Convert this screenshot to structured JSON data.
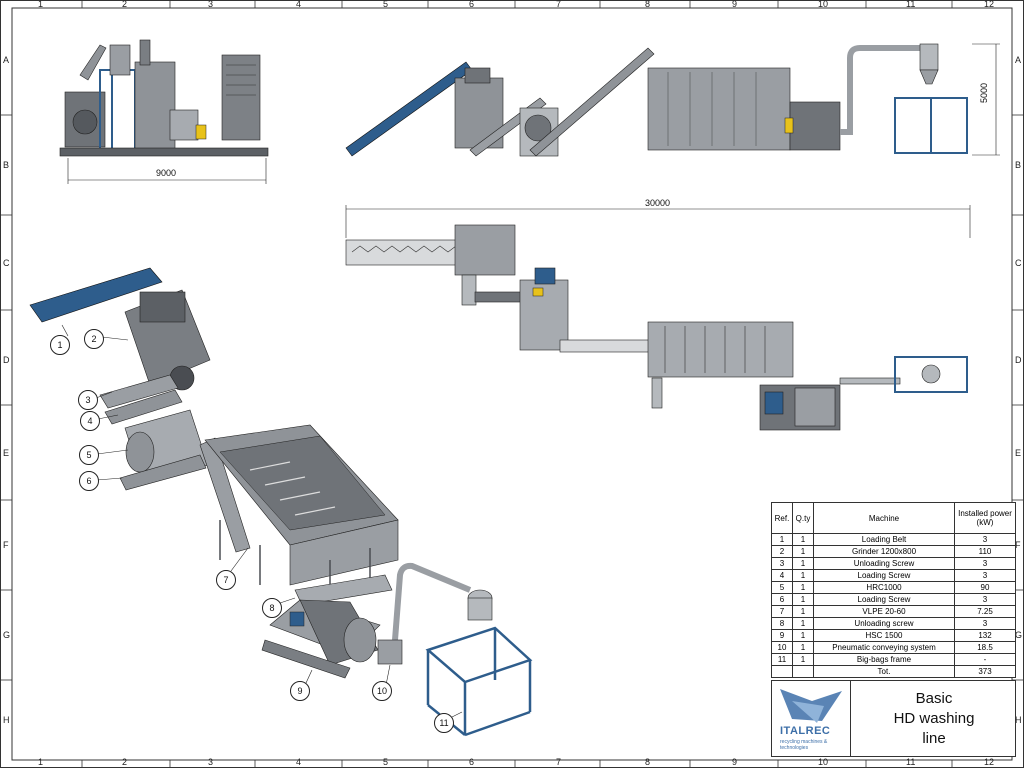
{
  "frame": {
    "col_numbers": [
      "1",
      "2",
      "3",
      "4",
      "5",
      "6",
      "7",
      "8",
      "9",
      "10",
      "11",
      "12"
    ],
    "row_letters": [
      "A",
      "B",
      "C",
      "D",
      "E",
      "F",
      "G",
      "H"
    ]
  },
  "dimensions": {
    "width_9000": "9000",
    "length_30000": "30000",
    "height_5000": "5000"
  },
  "callouts": [
    "1",
    "2",
    "3",
    "4",
    "5",
    "6",
    "7",
    "8",
    "9",
    "10",
    "11"
  ],
  "bom": {
    "headers": {
      "ref": "Ref.",
      "qty": "Q.ty",
      "machine": "Machine",
      "power": "Installed power (kW)"
    },
    "rows": [
      {
        "ref": "1",
        "qty": "1",
        "machine": "Loading Belt",
        "power": "3"
      },
      {
        "ref": "2",
        "qty": "1",
        "machine": "Grinder 1200x800",
        "power": "110"
      },
      {
        "ref": "3",
        "qty": "1",
        "machine": "Unloading Screw",
        "power": "3"
      },
      {
        "ref": "4",
        "qty": "1",
        "machine": "Loading Screw",
        "power": "3"
      },
      {
        "ref": "5",
        "qty": "1",
        "machine": "HRC1000",
        "power": "90"
      },
      {
        "ref": "6",
        "qty": "1",
        "machine": "Loading Screw",
        "power": "3"
      },
      {
        "ref": "7",
        "qty": "1",
        "machine": "VLPE 20-60",
        "power": "7.25"
      },
      {
        "ref": "8",
        "qty": "1",
        "machine": "Unloading screw",
        "power": "3"
      },
      {
        "ref": "9",
        "qty": "1",
        "machine": "HSC 1500",
        "power": "132"
      },
      {
        "ref": "10",
        "qty": "1",
        "machine": "Pneumatic conveying system",
        "power": "18.5"
      },
      {
        "ref": "11",
        "qty": "1",
        "machine": "Big-bags  frame",
        "power": "-"
      }
    ],
    "total_label": "Tot.",
    "total_value": "373"
  },
  "title_block": {
    "logo_name": "ITALREC",
    "logo_tagline": "recycling machines & technologies",
    "title_line1": "Basic",
    "title_line2": "HD washing",
    "title_line3": "line"
  },
  "colors": {
    "steel_blue": "#2e5d8c",
    "machine_grey": "#8f9398",
    "dark_grey": "#4a4d52",
    "accent_yellow": "#e8c21a",
    "logo_blue": "#3d6fa8"
  }
}
